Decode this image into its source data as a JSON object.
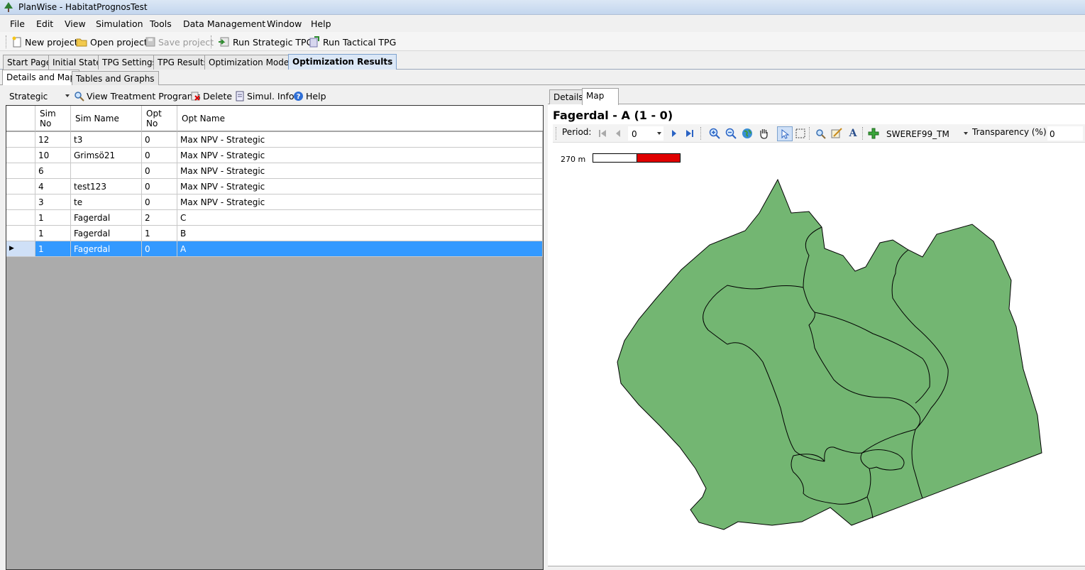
{
  "window": {
    "title": "PlanWise - HabitatPrognosTest"
  },
  "menu": [
    "File",
    "Edit",
    "View",
    "Simulation",
    "Tools",
    "Data Management",
    "Window",
    "Help"
  ],
  "toolbar": {
    "new_project": "New project",
    "open_project": "Open project",
    "save_project": "Save project",
    "run_strategic": "Run Strategic TPG",
    "run_tactical": "Run Tactical TPG"
  },
  "main_tabs": [
    "Start Page",
    "Initial State",
    "TPG Settings",
    "TPG Results",
    "Optimization Model",
    "Optimization Results"
  ],
  "sub_tabs": [
    "Details and Map",
    "Tables and Graphs"
  ],
  "left_toolbar": {
    "mode_select": "Strategic",
    "view_programs": "View Treatment Programs",
    "delete": "Delete",
    "simul_info": "Simul. Info",
    "help": "Help"
  },
  "grid": {
    "headers": {
      "sim_no_1": "Sim",
      "sim_no_2": "No",
      "sim_name": "Sim Name",
      "opt_no_1": "Opt",
      "opt_no_2": "No",
      "opt_name": "Opt Name"
    },
    "rows": [
      {
        "sim_no": "12",
        "sim_name": "t3",
        "opt_no": "0",
        "opt_name": "Max NPV - Strategic"
      },
      {
        "sim_no": "10",
        "sim_name": "Grimsö21",
        "opt_no": "0",
        "opt_name": "Max NPV - Strategic"
      },
      {
        "sim_no": "6",
        "sim_name": "",
        "opt_no": "0",
        "opt_name": "Max NPV - Strategic"
      },
      {
        "sim_no": "4",
        "sim_name": "test123",
        "opt_no": "0",
        "opt_name": "Max NPV - Strategic"
      },
      {
        "sim_no": "3",
        "sim_name": "te",
        "opt_no": "0",
        "opt_name": "Max NPV - Strategic"
      },
      {
        "sim_no": "1",
        "sim_name": "Fagerdal",
        "opt_no": "2",
        "opt_name": "C"
      },
      {
        "sim_no": "1",
        "sim_name": "Fagerdal",
        "opt_no": "1",
        "opt_name": "B"
      },
      {
        "sim_no": "1",
        "sim_name": "Fagerdal",
        "opt_no": "0",
        "opt_name": "A"
      }
    ],
    "selected_row": 7
  },
  "right_tabs": [
    "Details",
    "Map"
  ],
  "map": {
    "title": "Fagerdal - A (1 - 0)",
    "period_label": "Period:",
    "period_value": "0",
    "projection": "SWEREF99_TM",
    "transparency_label": "Transparency (%):",
    "transparency_value": "0",
    "scale_label": "270 m",
    "fill_color": "#73b672",
    "stroke_color": "#000000",
    "scale_color": "#e00000"
  }
}
